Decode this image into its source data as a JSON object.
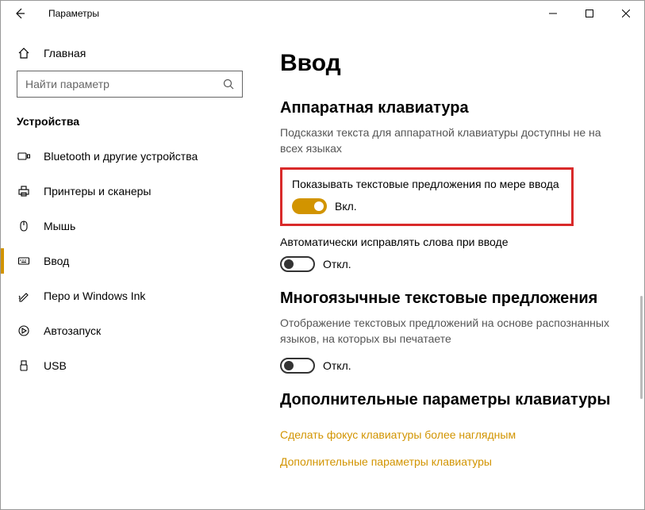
{
  "window": {
    "title": "Параметры"
  },
  "sidebar": {
    "home_label": "Главная",
    "search_placeholder": "Найти параметр",
    "category": "Устройства",
    "items": [
      {
        "label": "Bluetooth и другие устройства"
      },
      {
        "label": "Принтеры и сканеры"
      },
      {
        "label": "Мышь"
      },
      {
        "label": "Ввод"
      },
      {
        "label": "Перо и Windows Ink"
      },
      {
        "label": "Автозапуск"
      },
      {
        "label": "USB"
      }
    ],
    "active_index": 3
  },
  "main": {
    "heading": "Ввод",
    "section1": {
      "title": "Аппаратная клавиатура",
      "desc": "Подсказки текста для аппаратной клавиатуры доступны не на всех языках",
      "setting1": {
        "label": "Показывать текстовые предложения по мере ввода",
        "state_label": "Вкл.",
        "on": true
      },
      "setting2": {
        "label": "Автоматически исправлять слова при вводе",
        "state_label": "Откл.",
        "on": false
      }
    },
    "section2": {
      "title": "Многоязычные текстовые предложения",
      "desc": "Отображение текстовых предложений на основе распознанных языков, на которых вы печатаете",
      "setting1": {
        "state_label": "Откл.",
        "on": false
      }
    },
    "section3": {
      "title": "Дополнительные параметры клавиатуры",
      "link1": "Сделать фокус клавиатуры более наглядным",
      "link2": "Дополнительные параметры клавиатуры"
    }
  }
}
